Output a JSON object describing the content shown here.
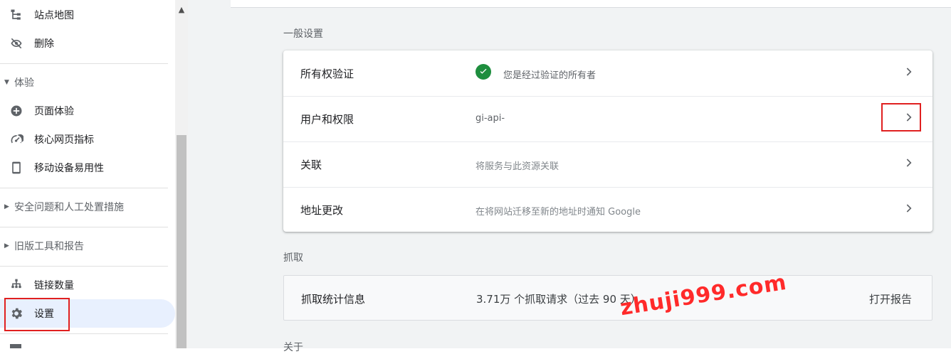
{
  "sidebar": {
    "items": [
      {
        "label": "站点地图",
        "icon": "sitemap-icon"
      },
      {
        "label": "删除",
        "icon": "eye-off-icon"
      },
      {
        "label": "页面体验",
        "icon": "plus-circle-icon"
      },
      {
        "label": "核心网页指标",
        "icon": "speedometer-icon"
      },
      {
        "label": "移动设备易用性",
        "icon": "smartphone-icon"
      },
      {
        "label": "链接数量",
        "icon": "network-icon"
      },
      {
        "label": "设置",
        "icon": "gear-icon"
      }
    ],
    "sections": {
      "experience": "体验",
      "security": "安全问题和人工处置措施",
      "legacy": "旧版工具和报告"
    }
  },
  "main": {
    "general_title": "一般设置",
    "rows": [
      {
        "label": "所有权验证",
        "desc": "您是经过验证的所有者"
      },
      {
        "label": "用户和权限",
        "desc": "gi-api-"
      },
      {
        "label": "关联",
        "desc": "将服务与此资源关联"
      },
      {
        "label": "地址更改",
        "desc": "在将网站迁移至新的地址时通知 Google"
      }
    ],
    "crawl_title": "抓取",
    "crawl": {
      "label": "抓取统计信息",
      "value": "3.71万 个抓取请求（过去 90 天）",
      "link": "打开报告"
    },
    "about_title": "关于"
  },
  "watermark": "zhuji999.com",
  "colors": {
    "accent_active": "#e8f0fe",
    "check_green": "#1e8e3e",
    "highlight_red": "#e02020"
  }
}
